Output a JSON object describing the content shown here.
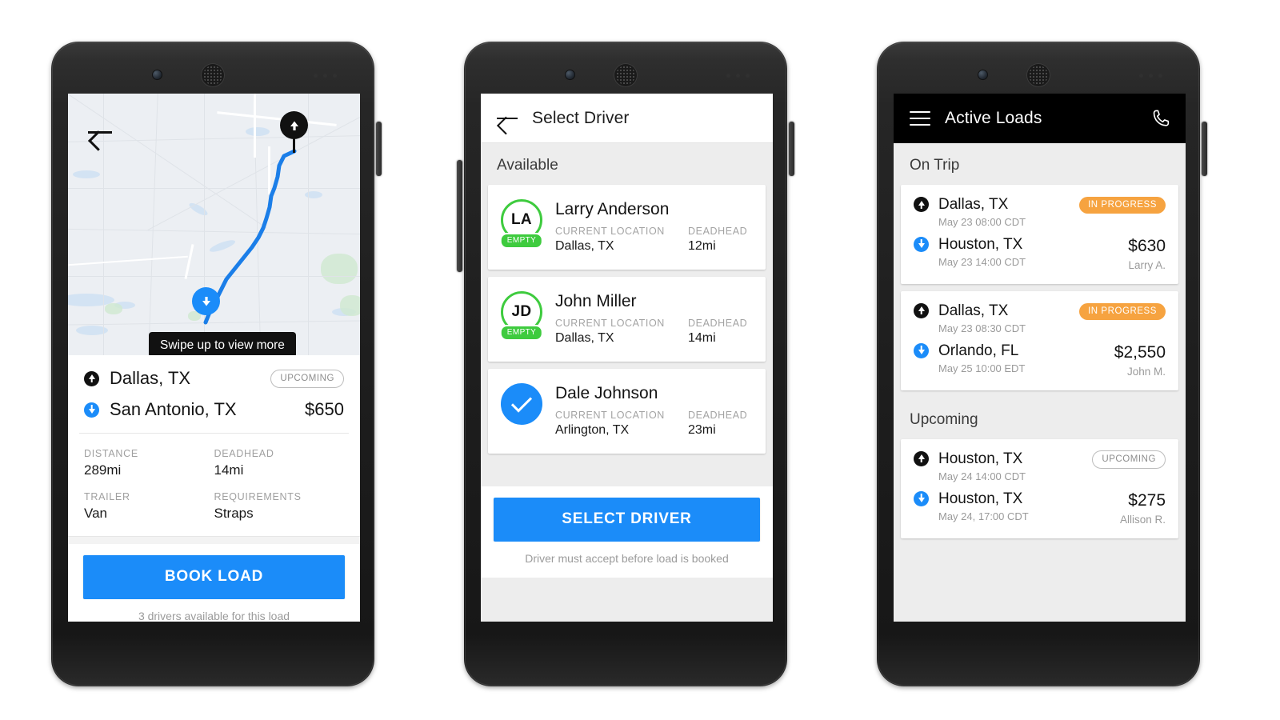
{
  "colors": {
    "accent_blue": "#1b8cf9",
    "status_orange": "#f6a340",
    "empty_green": "#3ecb3e",
    "appbar_dark": "#000000",
    "page_bg": "#ededed"
  },
  "phone1": {
    "map": {
      "back_label": "Back",
      "tooltip": "Swipe up to view more",
      "pickup_marker": "Dallas pickup pin",
      "dropoff_marker": "San Antonio dropoff pin"
    },
    "sheet": {
      "origin": "Dallas, TX",
      "destination": "San Antonio, TX",
      "status_badge": "UPCOMING",
      "price": "$650",
      "meta": [
        {
          "label": "DISTANCE",
          "value": "289mi"
        },
        {
          "label": "DEADHEAD",
          "value": "14mi"
        },
        {
          "label": "TRAILER",
          "value": "Van"
        },
        {
          "label": "REQUIREMENTS",
          "value": "Straps"
        }
      ],
      "cta_label": "BOOK LOAD",
      "cta_note": "3 drivers available for this load"
    }
  },
  "phone2": {
    "header": {
      "title": "Select Driver",
      "back_label": "Back"
    },
    "section_title": "Available",
    "labels": {
      "current_location": "CURRENT LOCATION",
      "deadhead": "DEADHEAD"
    },
    "drivers": [
      {
        "name": "Larry Anderson",
        "initials": "LA",
        "status_badge": "EMPTY",
        "current_location": "Dallas, TX",
        "deadhead": "12mi",
        "selected": false
      },
      {
        "name": "John Miller",
        "initials": "JD",
        "status_badge": "EMPTY",
        "current_location": "Dallas, TX",
        "deadhead": "14mi",
        "selected": false
      },
      {
        "name": "Dale Johnson",
        "initials": "",
        "status_badge": "",
        "current_location": "Arlington, TX",
        "deadhead": "23mi",
        "selected": true
      }
    ],
    "cta_label": "SELECT DRIVER",
    "cta_note": "Driver must accept before load is booked"
  },
  "phone3": {
    "header": {
      "title": "Active Loads",
      "menu_label": "Menu",
      "call_label": "Call"
    },
    "sections": [
      {
        "title": "On Trip",
        "loads": [
          {
            "origin": "Dallas, TX",
            "origin_time": "May 23 08:00 CDT",
            "destination": "Houston, TX",
            "destination_time": "May 23 14:00 CDT",
            "status_badge": "IN PROGRESS",
            "status_type": "inprogress",
            "price": "$630",
            "driver": "Larry A."
          },
          {
            "origin": "Dallas, TX",
            "origin_time": "May 23 08:30 CDT",
            "destination": "Orlando, FL",
            "destination_time": "May 25 10:00 EDT",
            "status_badge": "IN PROGRESS",
            "status_type": "inprogress",
            "price": "$2,550",
            "driver": "John M."
          }
        ]
      },
      {
        "title": "Upcoming",
        "loads": [
          {
            "origin": "Houston, TX",
            "origin_time": "May 24 14:00 CDT",
            "destination": "Houston, TX",
            "destination_time": "May 24, 17:00 CDT",
            "status_badge": "UPCOMING",
            "status_type": "upcoming",
            "price": "$275",
            "driver": "Allison R."
          }
        ]
      }
    ]
  }
}
